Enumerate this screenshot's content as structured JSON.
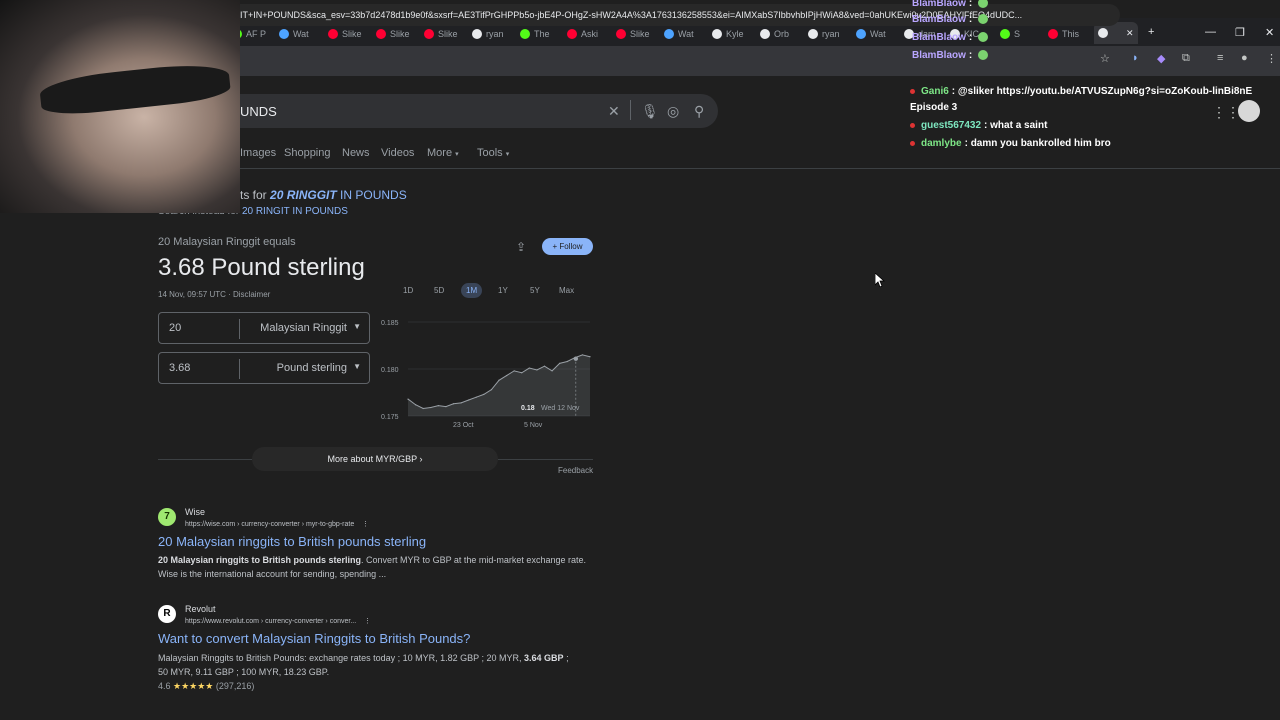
{
  "browser": {
    "tabs": [
      {
        "label": "AF P",
        "icon": "kick-icon",
        "color": "#53fc18"
      },
      {
        "label": "Wat",
        "icon": "web-icon",
        "color": "#4da3ff"
      },
      {
        "label": "Slike",
        "icon": "youtube-icon",
        "color": "#ff0033"
      },
      {
        "label": "Slike",
        "icon": "youtube-icon",
        "color": "#ff0033"
      },
      {
        "label": "Slike",
        "icon": "youtube-icon",
        "color": "#ff0033"
      },
      {
        "label": "ryan",
        "icon": "x-icon",
        "color": "#e8eaed"
      },
      {
        "label": "The",
        "icon": "kick-icon",
        "color": "#53fc18"
      },
      {
        "label": "Aski",
        "icon": "youtube-icon",
        "color": "#ff0033"
      },
      {
        "label": "Slike",
        "icon": "youtube-icon",
        "color": "#ff0033"
      },
      {
        "label": "Wat",
        "icon": "web-icon",
        "color": "#4da3ff"
      },
      {
        "label": "Kyle",
        "icon": "x-icon",
        "color": "#e8eaed"
      },
      {
        "label": "Orb",
        "icon": "x-icon",
        "color": "#e8eaed"
      },
      {
        "label": "ryan",
        "icon": "x-icon",
        "color": "#e8eaed"
      },
      {
        "label": "Wat",
        "icon": "web-icon",
        "color": "#4da3ff"
      },
      {
        "label": "dam",
        "icon": "x-icon",
        "color": "#e8eaed"
      },
      {
        "label": "KIC",
        "icon": "x-icon",
        "color": "#e8eaed"
      },
      {
        "label": "S",
        "icon": "kick-icon",
        "color": "#53fc18"
      },
      {
        "label": "This",
        "icon": "youtube-icon",
        "color": "#ff0033"
      }
    ],
    "url": "IT+IN+POUNDS&sca_esv=33b7d2478d1b9e0f&sxsrf=AE3TifPrGHPPb5o-jbE4P-OHgZ-sHW2A4A%3A1763136258553&ei=AIMXabS7IbbvhbIPjHWiA8&ved=0ahUKEwi0v2D0EAHYlFfEQ4dUDC..."
  },
  "search": {
    "query_visible": "UNDS",
    "tabs": [
      "Images",
      "Shopping",
      "News",
      "Videos",
      "More",
      "Tools"
    ],
    "showing_prefix": "ts for ",
    "showing_link": "20 RINGGIT",
    "showing_suffix": " IN POUNDS",
    "instead_prefix": "Search instead for ",
    "instead_link": "20 RINGIT IN POUNDS"
  },
  "converter": {
    "equals_label": "20 Malaysian Ringgit equals",
    "result": "3.68 Pound sterling",
    "timestamp": "14 Nov, 09:57 UTC",
    "disclaimer": "Disclaimer",
    "follow_label": "Follow",
    "from_amount": "20",
    "from_currency": "Malaysian Ringgit",
    "to_amount": "3.68",
    "to_currency": "Pound sterling",
    "ranges": [
      "1D",
      "5D",
      "1M",
      "1Y",
      "5Y",
      "Max"
    ],
    "selected_range": "1M",
    "more_about": "More about MYR/GBP",
    "feedback": "Feedback"
  },
  "chart_data": {
    "type": "area",
    "y_ticks": [
      "0.185",
      "0.180",
      "0.175"
    ],
    "x_ticks": [
      "23 Oct",
      "5 Nov"
    ],
    "ylim": [
      0.175,
      0.185
    ],
    "values": [
      0.1768,
      0.1762,
      0.1758,
      0.1759,
      0.1761,
      0.176,
      0.1763,
      0.1764,
      0.1767,
      0.177,
      0.1773,
      0.1778,
      0.1788,
      0.1793,
      0.1798,
      0.1796,
      0.1801,
      0.1799,
      0.1803,
      0.1798,
      0.1806,
      0.1808,
      0.1812,
      0.1815,
      0.1813
    ],
    "tooltip_value": "0.18",
    "tooltip_date": "Wed 12 Nov",
    "color": "#9aa0a6"
  },
  "results": [
    {
      "site": "Wise",
      "url": "https://wise.com › currency-converter › myr-to-gbp-rate",
      "title": "20 Malaysian ringgits to British pounds sterling",
      "snippet_bold": "20 Malaysian ringgits to British pounds sterling",
      "snippet": ". Convert MYR to GBP at the mid-market exchange rate. Wise is the international account for sending, spending ...",
      "favicon_color": "#9fe870"
    },
    {
      "site": "Revolut",
      "url": "https://www.revolut.com › currency-converter › conver...",
      "title": "Want to convert Malaysian Ringgits to British Pounds?",
      "snippet_line1": "Malaysian Ringgits to British Pounds: exchange rates today ; 10 MYR, 1.82 GBP ; 20 MYR, ",
      "snippet_bold": "3.64 GBP",
      "snippet_end": " ;",
      "snippet_line2": "50 MYR, 9.11 GBP ; 100 MYR, 18.23 GBP.",
      "rating": "4.6",
      "stars": "★★★★★",
      "reviews": "(297,216)",
      "favicon_color": "#ffffff"
    }
  ],
  "chat": [
    {
      "user": "BlamBlaow",
      "msg": "",
      "color": "#b9a6ff"
    },
    {
      "user": "BlamBlaow",
      "msg": "",
      "color": "#b9a6ff"
    },
    {
      "user": "BlamBlaow",
      "msg": "",
      "color": "#b9a6ff"
    },
    {
      "user": "BlamBlaow",
      "msg": "",
      "color": "#b9a6ff"
    },
    {
      "user": "Gani6",
      "msg": "@sliker https://youtu.be/ATVUSZupN6g?si=oZoKoub-linBi8nE",
      "color": "#7ee787"
    },
    {
      "user": "",
      "msg": "Episode 3",
      "color": "#ffffff"
    },
    {
      "user": "guest567432",
      "msg": "what a saint",
      "color": "#7ee7c0"
    },
    {
      "user": "damlybe",
      "msg": "damn you bankrolled him bro",
      "color": "#7ee787"
    }
  ]
}
